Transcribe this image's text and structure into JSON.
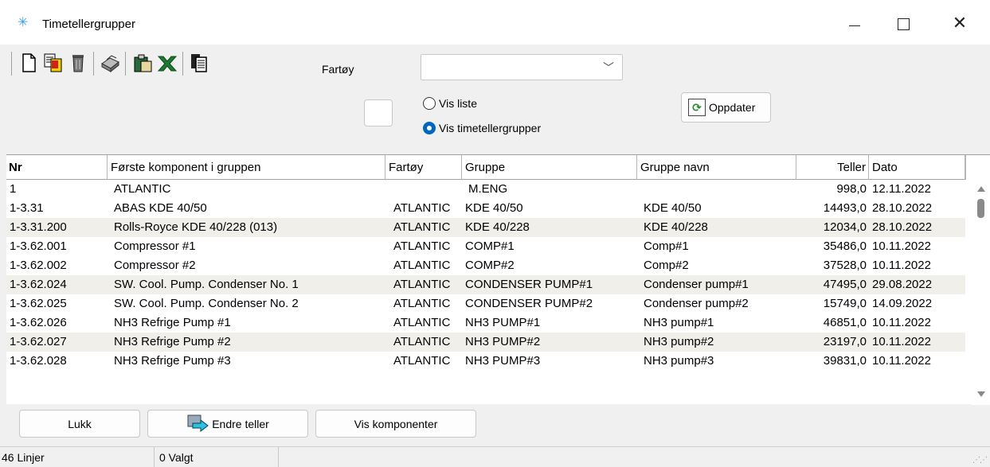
{
  "window": {
    "title": "Timetellergrupper",
    "minimize": "—",
    "maximize": "☐",
    "close": "✕"
  },
  "toolbar": {
    "icons": [
      "new-document-icon",
      "copy-document-icon",
      "delete-trash-icon",
      "print-icon",
      "paste-clipboard-icon",
      "excel-export-icon",
      "copy-pages-icon"
    ],
    "fartoy_label": "Fartøy",
    "fartoy_value": "",
    "radio_vis_liste": "Vis liste",
    "radio_vis_grupper": "Vis timetellergrupper",
    "selected_radio": "Vis timetellergrupper",
    "oppdater_label": "Oppdater"
  },
  "grid": {
    "columns": [
      "Nr",
      "Første komponent i gruppen",
      "Fartøy",
      "Gruppe",
      "Gruppe navn",
      "Teller",
      "Dato"
    ],
    "rows": [
      {
        "nr": "1",
        "komponent": "ATLANTIC",
        "fartoy": "",
        "gruppe": "M.ENG",
        "gruppe_navn": "",
        "teller": "998,0",
        "dato": "12.11.2022"
      },
      {
        "nr": "1-3.31",
        "komponent": "ABAS KDE 40/50",
        "fartoy": "ATLANTIC",
        "gruppe": "KDE 40/50",
        "gruppe_navn": "KDE 40/50",
        "teller": "14493,0",
        "dato": "28.10.2022"
      },
      {
        "nr": "1-3.31.200",
        "komponent": "Rolls-Royce KDE 40/228 (013)",
        "fartoy": "ATLANTIC",
        "gruppe": "KDE 40/228",
        "gruppe_navn": "KDE 40/228",
        "teller": "12034,0",
        "dato": "28.10.2022"
      },
      {
        "nr": "1-3.62.001",
        "komponent": "Compressor #1",
        "fartoy": "ATLANTIC",
        "gruppe": "COMP#1",
        "gruppe_navn": "Comp#1",
        "teller": "35486,0",
        "dato": "10.11.2022"
      },
      {
        "nr": "1-3.62.002",
        "komponent": "Compressor #2",
        "fartoy": "ATLANTIC",
        "gruppe": "COMP#2",
        "gruppe_navn": "Comp#2",
        "teller": "37528,0",
        "dato": "10.11.2022"
      },
      {
        "nr": "1-3.62.024",
        "komponent": "SW. Cool. Pump. Condenser No. 1",
        "fartoy": "ATLANTIC",
        "gruppe": "CONDENSER PUMP#1",
        "gruppe_navn": "Condenser pump#1",
        "teller": "47495,0",
        "dato": "29.08.2022"
      },
      {
        "nr": "1-3.62.025",
        "komponent": "SW. Cool. Pump. Condenser No. 2",
        "fartoy": "ATLANTIC",
        "gruppe": "CONDENSER PUMP#2",
        "gruppe_navn": "Condenser pump#2",
        "teller": "15749,0",
        "dato": "14.09.2022"
      },
      {
        "nr": "1-3.62.026",
        "komponent": "NH3 Refrige Pump #1",
        "fartoy": "ATLANTIC",
        "gruppe": "NH3 PUMP#1",
        "gruppe_navn": "NH3 pump#1",
        "teller": "46851,0",
        "dato": "10.11.2022"
      },
      {
        "nr": "1-3.62.027",
        "komponent": "NH3 Refrige Pump #2",
        "fartoy": "ATLANTIC",
        "gruppe": "NH3 PUMP#2",
        "gruppe_navn": "NH3 pump#2",
        "teller": "23197,0",
        "dato": "10.11.2022"
      },
      {
        "nr": "1-3.62.028",
        "komponent": "NH3 Refrige Pump #3",
        "fartoy": "ATLANTIC",
        "gruppe": "NH3 PUMP#3",
        "gruppe_navn": "NH3 pump#3",
        "teller": "39831,0",
        "dato": "10.11.2022"
      }
    ]
  },
  "buttons": {
    "lukk": "Lukk",
    "endre_teller": "Endre teller",
    "vis_komponenter": "Vis komponenter"
  },
  "status": {
    "lines": "46 Linjer",
    "selected": "0 Valgt"
  },
  "colors": {
    "alt_row": "#f0efe9",
    "radio_selected": "#0067c0",
    "background": "#f0f0f0"
  }
}
